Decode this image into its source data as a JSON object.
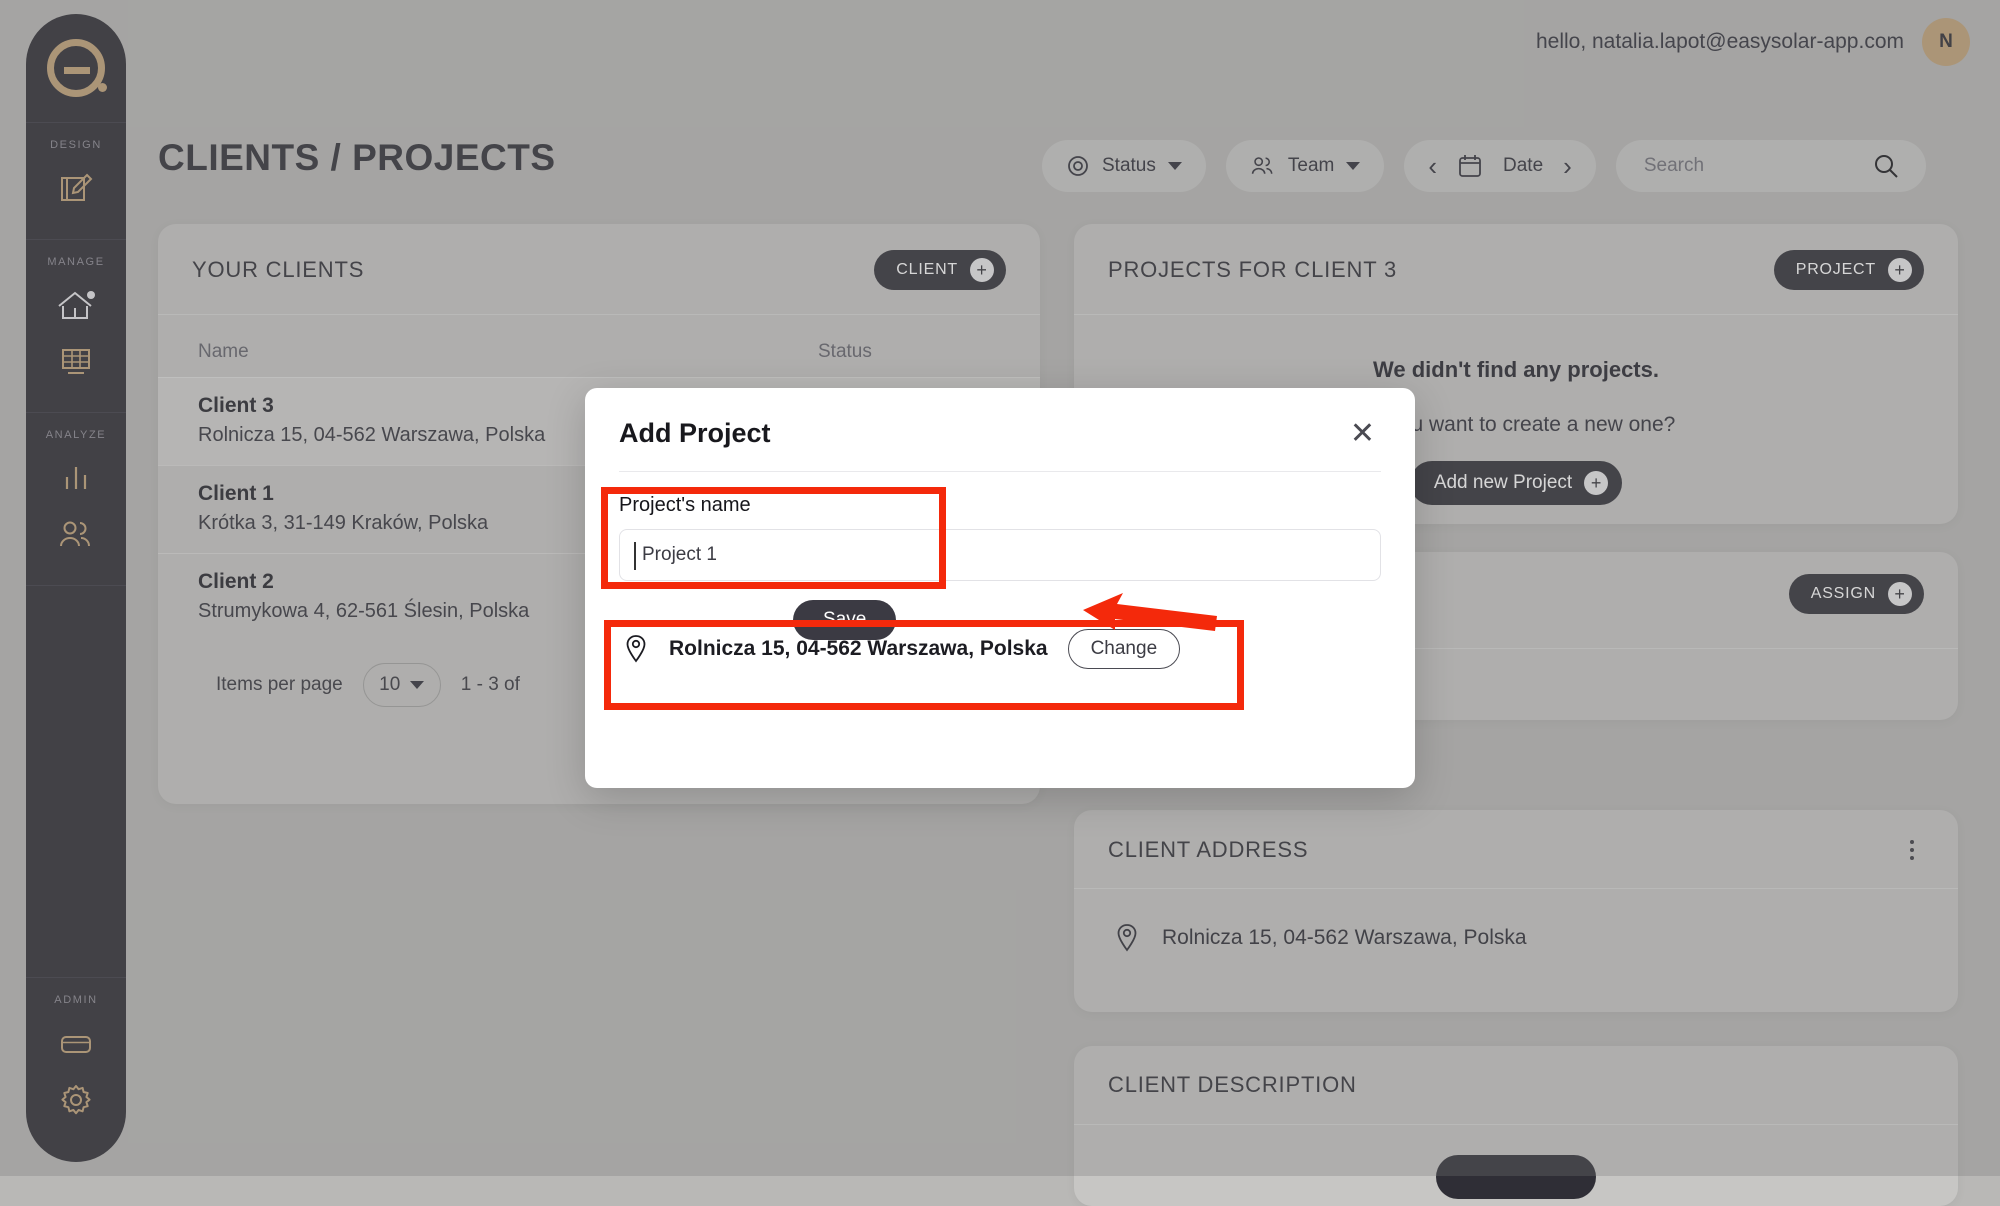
{
  "app": {
    "brand": "easysolar",
    "logo_icon": "e-logo-icon"
  },
  "topbar": {
    "greeting": "hello, natalia.lapot@easysolar-app.com",
    "avatar_initial": "N"
  },
  "sidebar": {
    "sections": [
      {
        "label": "DESIGN",
        "items": [
          {
            "icon": "design-pencil-icon",
            "name": "sidebar-item-design",
            "active": false
          }
        ]
      },
      {
        "label": "MANAGE",
        "items": [
          {
            "icon": "house-icon",
            "name": "sidebar-item-projects",
            "active": true
          },
          {
            "icon": "solar-panel-icon",
            "name": "sidebar-item-panels",
            "active": false
          }
        ]
      },
      {
        "label": "ANALYZE",
        "items": [
          {
            "icon": "bar-chart-icon",
            "name": "sidebar-item-reports",
            "active": false
          },
          {
            "icon": "people-icon",
            "name": "sidebar-item-clients",
            "active": false
          }
        ]
      },
      {
        "label": "ADMIN",
        "items": [
          {
            "icon": "card-icon",
            "name": "sidebar-item-billing",
            "active": false
          },
          {
            "icon": "gear-icon",
            "name": "sidebar-item-settings",
            "active": false
          }
        ]
      }
    ]
  },
  "page": {
    "title": "CLIENTS / PROJECTS"
  },
  "filters": {
    "status": {
      "label": "Status",
      "icon": "target-circle-icon"
    },
    "team": {
      "label": "Team",
      "icon": "people-icon"
    },
    "date": {
      "label": "Date",
      "icon": "calendar-icon",
      "prev": "‹",
      "next": "›"
    },
    "search": {
      "placeholder": "Search",
      "value": "",
      "icon": "search-icon"
    }
  },
  "clients_card": {
    "title": "YOUR CLIENTS",
    "add_button": "CLIENT",
    "columns": {
      "name": "Name",
      "status": "Status"
    },
    "rows": [
      {
        "name": "Client 3",
        "address": "Rolnicza 15, 04-562 Warszawa, Polska",
        "selected": true
      },
      {
        "name": "Client 1",
        "address": "Krótka 3, 31-149 Kraków, Polska",
        "selected": false
      },
      {
        "name": "Client 2",
        "address": "Strumykowa 4, 62-561 Ślesin, Polska",
        "selected": false
      }
    ],
    "pagination": {
      "items_per_page_label": "Items per page",
      "items_per_page_value": "10",
      "range": "1 - 3 of"
    }
  },
  "projects_card": {
    "title": "PROJECTS FOR CLIENT 3",
    "add_button": "PROJECT",
    "empty_title": "We didn't find any projects.",
    "empty_subtitle": "Do you want to create a new one?",
    "empty_button": "Add new Project"
  },
  "assign_card": {
    "add_button": "ASSIGN"
  },
  "address_card": {
    "title": "CLIENT ADDRESS",
    "address": "Rolnicza 15, 04-562 Warszawa, Polska",
    "menu_icon": "kebab-menu-icon",
    "pin_icon": "map-pin-icon"
  },
  "description_card": {
    "title": "CLIENT DESCRIPTION"
  },
  "modal": {
    "title": "Add Project",
    "close_icon": "close-icon",
    "name_label": "Project's name",
    "name_value": "Project 1",
    "address": "Rolnicza 15, 04-562 Warszawa, Polska",
    "address_pin_icon": "map-pin-icon",
    "change_button": "Change",
    "save_button": "Save"
  },
  "annotations": {
    "highlight_color": "#F4290B",
    "boxes": [
      "project-name-field",
      "project-address-row"
    ],
    "arrow": "points-to-save-button"
  }
}
